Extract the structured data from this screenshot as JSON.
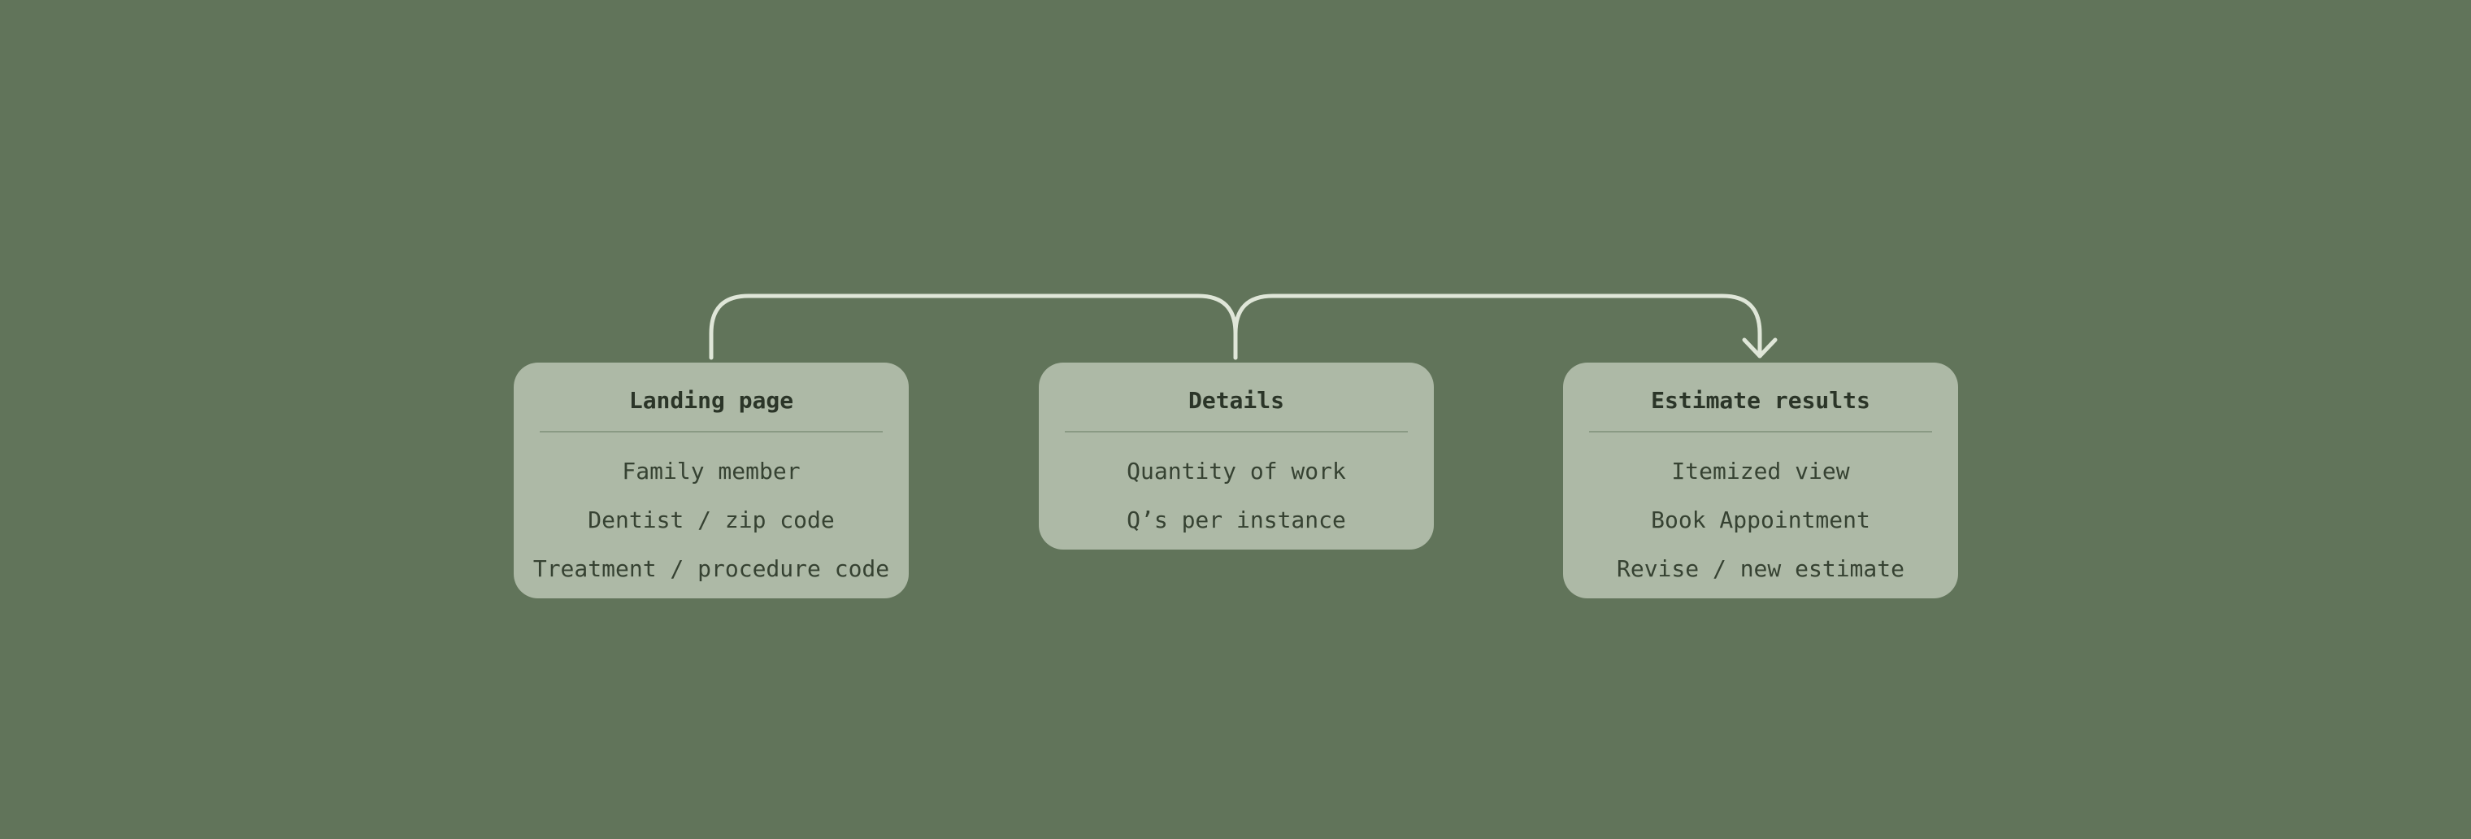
{
  "colors": {
    "background": "#61745a",
    "card": "#adb9a6",
    "connector": "#dfe6d8",
    "text": "#2f3a2c"
  },
  "steps": [
    {
      "title": "Landing page",
      "items": [
        "Family member",
        "Dentist / zip code",
        "Treatment / procedure code"
      ]
    },
    {
      "title": "Details",
      "items": [
        "Quantity of work",
        "Q’s per instance"
      ]
    },
    {
      "title": "Estimate results",
      "items": [
        "Itemized view",
        "Book Appointment",
        "Revise / new estimate"
      ]
    }
  ],
  "connectors": [
    {
      "from": "Landing page",
      "to": "Details"
    },
    {
      "from": "Details",
      "to": "Estimate results",
      "arrow": "down-arrow-icon"
    }
  ]
}
